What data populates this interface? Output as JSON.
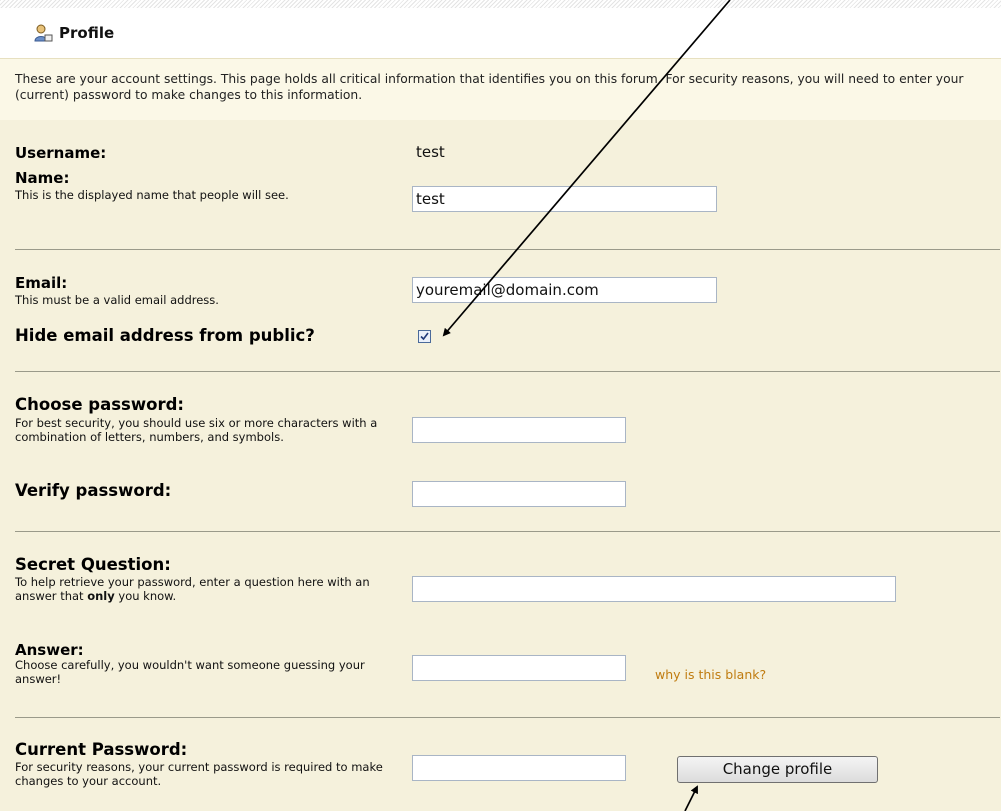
{
  "header": {
    "title": "Profile",
    "icon": "user-profile-icon"
  },
  "intro": "These are your account settings. This page holds all critical information that identifies you on this forum. For security reasons, you will need to enter your (current) password to make changes to this information.",
  "fields": {
    "username": {
      "label": "Username:",
      "value": "test"
    },
    "name": {
      "label": "Name:",
      "description": "This is the displayed name that people will see.",
      "value": "test"
    },
    "email": {
      "label": "Email:",
      "description": "This must be a valid email address.",
      "value": "youremail@domain.com"
    },
    "hide_email": {
      "label": "Hide email address from public?",
      "checked": true
    },
    "choose_password": {
      "label": "Choose password:",
      "description": "For best security, you should use six or more characters with a combination of letters, numbers, and symbols.",
      "value": ""
    },
    "verify_password": {
      "label": "Verify password:",
      "value": ""
    },
    "secret_question": {
      "label": "Secret Question:",
      "description_before": "To help retrieve your password, enter a question here with an answer that ",
      "description_bold": "only",
      "description_after": " you know.",
      "value": ""
    },
    "answer": {
      "label": "Answer:",
      "description": "Choose carefully, you wouldn't want someone guessing your answer!",
      "value": "",
      "link": "why is this blank?"
    },
    "current_password": {
      "label": "Current Password:",
      "description": "For security reasons, your current password is required to make changes to your account.",
      "value": ""
    }
  },
  "submit_label": "Change profile",
  "colors": {
    "form_bg": "#f5f1dc",
    "intro_bg": "#fbf8e7",
    "link": "#c07c10"
  }
}
